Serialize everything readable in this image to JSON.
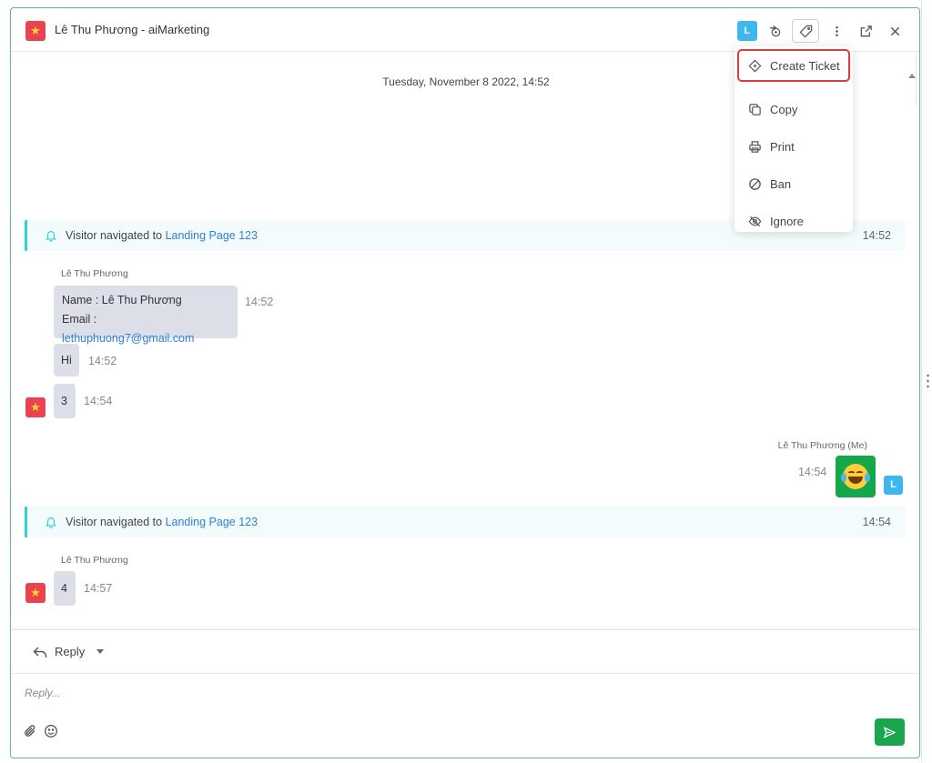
{
  "header": {
    "title": "Lê Thu Phương - aiMarketing",
    "avatar_letter": "L",
    "flag_glyph": "★",
    "icons": [
      "transfer-icon",
      "tag-icon",
      "more-vertical-icon",
      "external-link-icon",
      "close-icon"
    ]
  },
  "menu": {
    "items": [
      {
        "label": "Create Ticket",
        "icon": "ticket-icon"
      },
      {
        "label": "Copy",
        "icon": "copy-icon"
      },
      {
        "label": "Print",
        "icon": "print-icon"
      },
      {
        "label": "Ban",
        "icon": "ban-icon"
      },
      {
        "label": "Ignore",
        "icon": "eye-off-icon"
      }
    ]
  },
  "chat": {
    "date": "Tuesday, November 8 2022, 14:52",
    "event1": {
      "prefix": "Visitor navigated to ",
      "link": "Landing Page 123",
      "time": "14:52"
    },
    "sender1": "Lê Thu Phương",
    "info_name": "Name : Lê Thu Phương",
    "info_email_label": "Email : ",
    "info_email": "lethuphuong7@gmail.com",
    "info_time": "14:52",
    "msg_hi": "Hi",
    "msg_hi_time": "14:52",
    "msg_3": "3",
    "msg_3_time": "14:54",
    "me_sender": "Lê Thu Phương (Me)",
    "me_time": "14:54",
    "me_avatar": "L",
    "event2": {
      "prefix": "Visitor navigated to ",
      "link": "Landing Page 123",
      "time": "14:54"
    },
    "sender2": "Lê Thu Phương",
    "msg_4": "4",
    "msg_4_time": "14:57"
  },
  "reply": {
    "tab_label": "Reply",
    "placeholder": "Reply..."
  },
  "colors": {
    "accent_green": "#14a84a",
    "avatar_blue": "#3db8ef",
    "link_blue": "#2f7fd8",
    "highlight_red": "#e03a3a",
    "flag_red": "#e8434f"
  }
}
